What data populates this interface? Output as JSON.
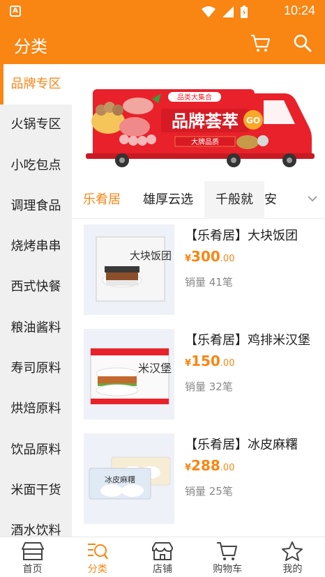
{
  "status_bar": {
    "time": "10:24",
    "notification_letter": "A"
  },
  "header": {
    "title": "分类"
  },
  "sidebar": {
    "items": [
      {
        "label": "品牌专区",
        "active": true
      },
      {
        "label": "火锅专区"
      },
      {
        "label": "小吃包点"
      },
      {
        "label": "调理食品"
      },
      {
        "label": "烧烤串串"
      },
      {
        "label": "西式快餐"
      },
      {
        "label": "粮油酱料"
      },
      {
        "label": "寿司原料"
      },
      {
        "label": "烘焙原料"
      },
      {
        "label": "饮品原料"
      },
      {
        "label": "米面干货"
      },
      {
        "label": "酒水饮料"
      }
    ]
  },
  "banner": {
    "ribbon": "品类大集合",
    "title": "品牌荟萃",
    "subtitle": "大牌品质",
    "badge": "GO"
  },
  "brand_tabs": {
    "items": [
      {
        "label": "乐肴居",
        "active": true
      },
      {
        "label": "雄厚云选"
      },
      {
        "label": "千般就"
      },
      {
        "label": "安"
      }
    ]
  },
  "products": [
    {
      "name": "【乐肴居】大块饭团",
      "currency": "¥",
      "price_int": "300",
      "price_dec": ".00",
      "sales": "销量 41笔"
    },
    {
      "name": "【乐肴居】鸡排米汉堡",
      "currency": "¥",
      "price_int": "150",
      "price_dec": ".00",
      "sales": "销量 32笔"
    },
    {
      "name": "【乐肴居】冰皮麻糬",
      "currency": "¥",
      "price_int": "288",
      "price_dec": ".00",
      "sales": "销量 25笔"
    }
  ],
  "product_labels": {
    "p1": "大块饭团",
    "p2": "米汉堡",
    "p3": "冰皮麻糬"
  },
  "tab_bar": {
    "items": [
      {
        "label": "首页"
      },
      {
        "label": "分类",
        "active": true
      },
      {
        "label": "店铺"
      },
      {
        "label": "购物车"
      },
      {
        "label": "我的"
      }
    ]
  },
  "colors": {
    "accent": "#f98513",
    "banner_red": "#e8212a"
  }
}
